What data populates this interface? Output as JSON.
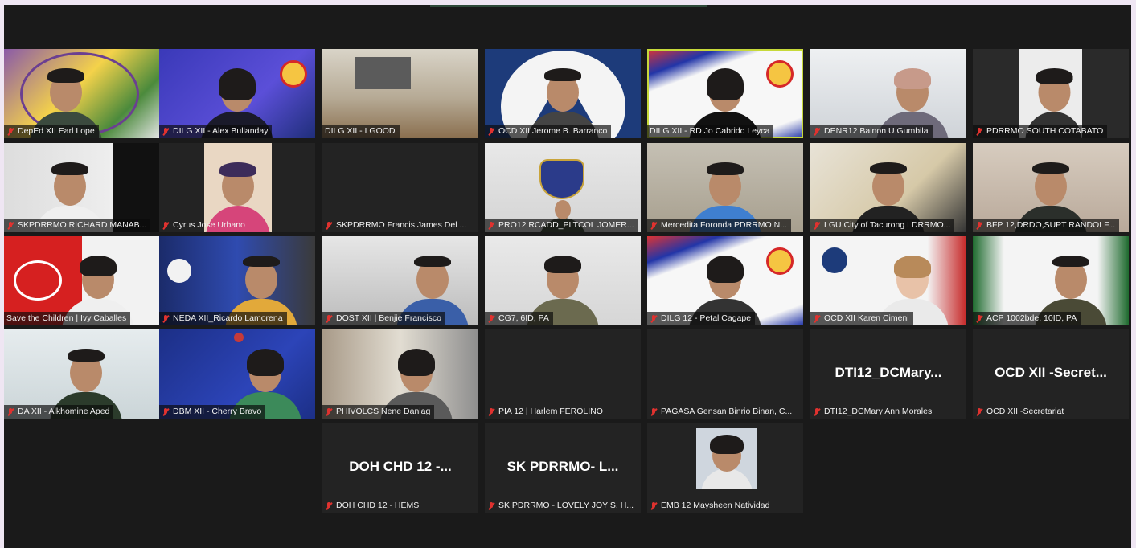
{
  "colors": {
    "frame": "#1a1a1a",
    "tile_empty": "#232323",
    "active_border": "#c7d93a",
    "mic_muted": "#e0322f"
  },
  "participants": [
    {
      "name": "DepEd XII Earl Lope"
    },
    {
      "name": "DILG XII - Alex Bullanday"
    },
    {
      "name": "DILG XII - LGOOD"
    },
    {
      "name": "OCD XII Jerome B. Barranco"
    },
    {
      "name": "DILG XII - RD Jo Cabrido Leyca"
    },
    {
      "name": "DENR12 Bainon U.Gumbila"
    },
    {
      "name": "PDRRMO SOUTH COTABATO"
    },
    {
      "name": "SKPDRRMO RICHARD MANAB..."
    },
    {
      "name": "Cyrus Jose Urbano"
    },
    {
      "name": "SKPDRRMO Francis James Del ..."
    },
    {
      "name": "PRO12 RCADD_PLTCOL JOMER..."
    },
    {
      "name": "Mercedita Foronda PDRRMO N..."
    },
    {
      "name": "LGU City of Tacurong LDRRMO..."
    },
    {
      "name": "BFP 12,DRDO,SUPT RANDOLF..."
    },
    {
      "name": "Save the Children | Ivy Caballes"
    },
    {
      "name": "NEDA XII_Ricardo Lamorena"
    },
    {
      "name": "DOST XII | Benjie Francisco"
    },
    {
      "name": "CG7, 6ID, PA"
    },
    {
      "name": "DILG 12 - Petal Cagape"
    },
    {
      "name": "OCD XII Karen Cimeni"
    },
    {
      "name": "ACP 1002bde, 10ID, PA"
    },
    {
      "name": "DA XII - Alkhomine Aped"
    },
    {
      "name": "DBM XII - Cherry Bravo"
    },
    {
      "name": "PHIVOLCS Nene Danlag"
    },
    {
      "name": "PIA 12 | Harlem FEROLINO"
    },
    {
      "name": "PAGASA Gensan Binrio Binan, C..."
    },
    {
      "name": "DTI12_DCMary Ann Morales",
      "display": "DTI12_DCMary..."
    },
    {
      "name": "OCD XII -Secretariat",
      "display": "OCD XII -Secret..."
    },
    {
      "name": "DOH CHD 12 - HEMS",
      "display": "DOH CHD 12 -..."
    },
    {
      "name": "SK PDRRMO - LOVELY JOY S. H...",
      "display": "SK PDRRMO- L..."
    },
    {
      "name": "EMB 12 Maysheen Natividad"
    }
  ]
}
